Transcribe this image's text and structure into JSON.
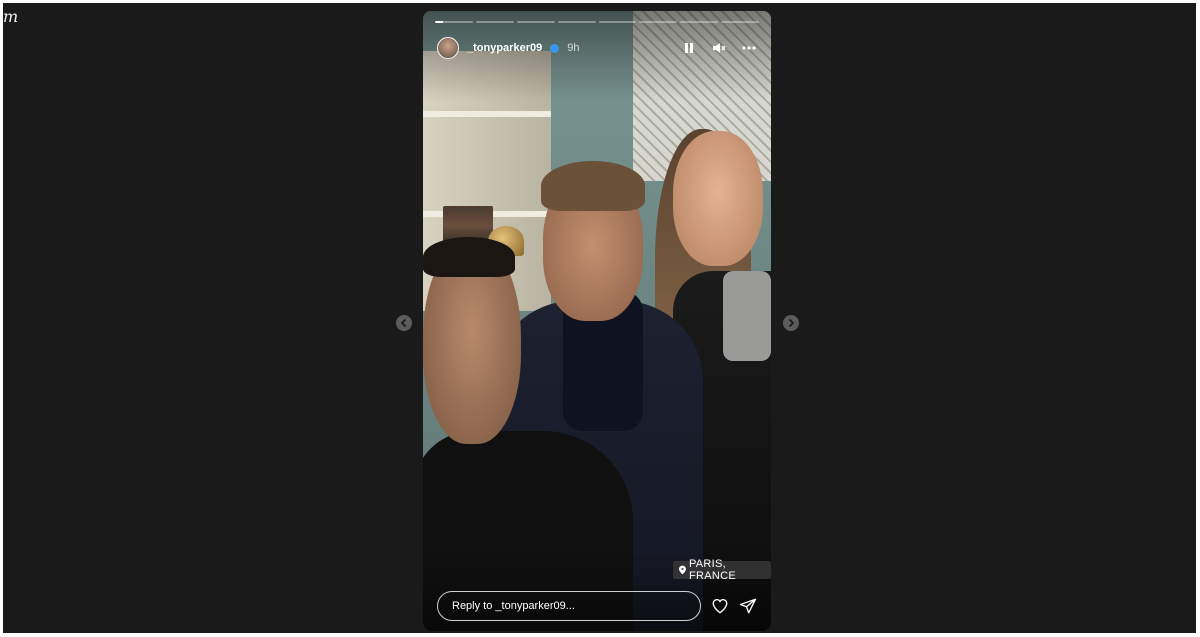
{
  "window": {
    "logo_fragment": "m"
  },
  "story": {
    "progress_segments": [
      1,
      1,
      1,
      1,
      1,
      1,
      1,
      1
    ],
    "current_segment_index": 0,
    "current_segment_fraction": 0.2,
    "user": {
      "username": "_tonyparker09",
      "verified": true,
      "time": "9h"
    },
    "controls": {
      "pause_icon": "pause-icon",
      "mute_icon": "volume-mute-icon",
      "more_icon": "more-horizontal-icon"
    },
    "location": {
      "icon": "location-pin-icon",
      "label": "PARIS, FRANCE"
    },
    "reply": {
      "placeholder": "Reply to _tonyparker09..."
    },
    "actions": {
      "like_icon": "heart-icon",
      "share_icon": "send-icon"
    }
  },
  "navigation": {
    "prev_icon": "chevron-left-icon",
    "next_icon": "chevron-right-icon"
  },
  "colors": {
    "background": "#1a1a1a",
    "verified": "#3897f0"
  }
}
